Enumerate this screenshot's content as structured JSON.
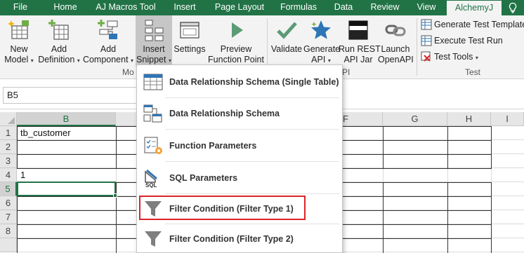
{
  "tabs": [
    {
      "label": "File"
    },
    {
      "label": "Home"
    },
    {
      "label": "AJ Macros Tool"
    },
    {
      "label": "Insert"
    },
    {
      "label": "Page Layout"
    },
    {
      "label": "Formulas"
    },
    {
      "label": "Data"
    },
    {
      "label": "Review"
    },
    {
      "label": "View"
    },
    {
      "label": "AlchemyJ"
    }
  ],
  "ribbon": {
    "buttons": [
      {
        "line1": "New",
        "line2": "Model",
        "caret": "▾"
      },
      {
        "line1": "Add",
        "line2": "Definition",
        "caret": "▾"
      },
      {
        "line1": "Add",
        "line2": "Component",
        "caret": "▾"
      },
      {
        "line1": "Insert",
        "line2": "Snippet",
        "caret": "▾"
      },
      {
        "line1": "Settings",
        "line2": ""
      },
      {
        "line1": "Preview",
        "line2": "Function Point"
      },
      {
        "line1": "Validate",
        "line2": ""
      },
      {
        "line1": "Generate",
        "line2": "API",
        "caret": "▾"
      },
      {
        "line1": "Run REST",
        "line2": "API Jar"
      },
      {
        "line1": "Launch",
        "line2": "OpenAPI"
      }
    ],
    "small_buttons": [
      {
        "label": "Generate Test Template"
      },
      {
        "label": "Execute Test Run"
      },
      {
        "label": "Test Tools",
        "caret": "▾"
      }
    ],
    "group_labels": {
      "model": "Mo",
      "api": "PI",
      "test": "Test"
    }
  },
  "name_box": {
    "value": "B5"
  },
  "columns": [
    "B",
    "F",
    "G",
    "H",
    "I"
  ],
  "rows": [
    "1",
    "2",
    "3",
    "4",
    "5",
    "6",
    "7",
    "8"
  ],
  "cells": {
    "B1": "tb_customer",
    "B4": "1"
  },
  "menu": {
    "items": [
      {
        "label": "Data Relationship Schema (Single Table)",
        "icon": "table-icon"
      },
      {
        "label": "Data Relationship Schema",
        "icon": "relationship-icon"
      },
      {
        "label": "Function Parameters",
        "icon": "checklist-gear-icon"
      },
      {
        "label": "SQL Parameters",
        "icon": "sql-icon"
      },
      {
        "label": "Filter Condition (Filter Type 1)",
        "icon": "funnel-icon"
      },
      {
        "label": "Filter Condition (Filter Type 2)",
        "icon": "funnel-icon"
      }
    ]
  },
  "colors": {
    "excel_green": "#217346",
    "highlight_red": "#d9252a",
    "accent_blue": "#2e75b6"
  }
}
